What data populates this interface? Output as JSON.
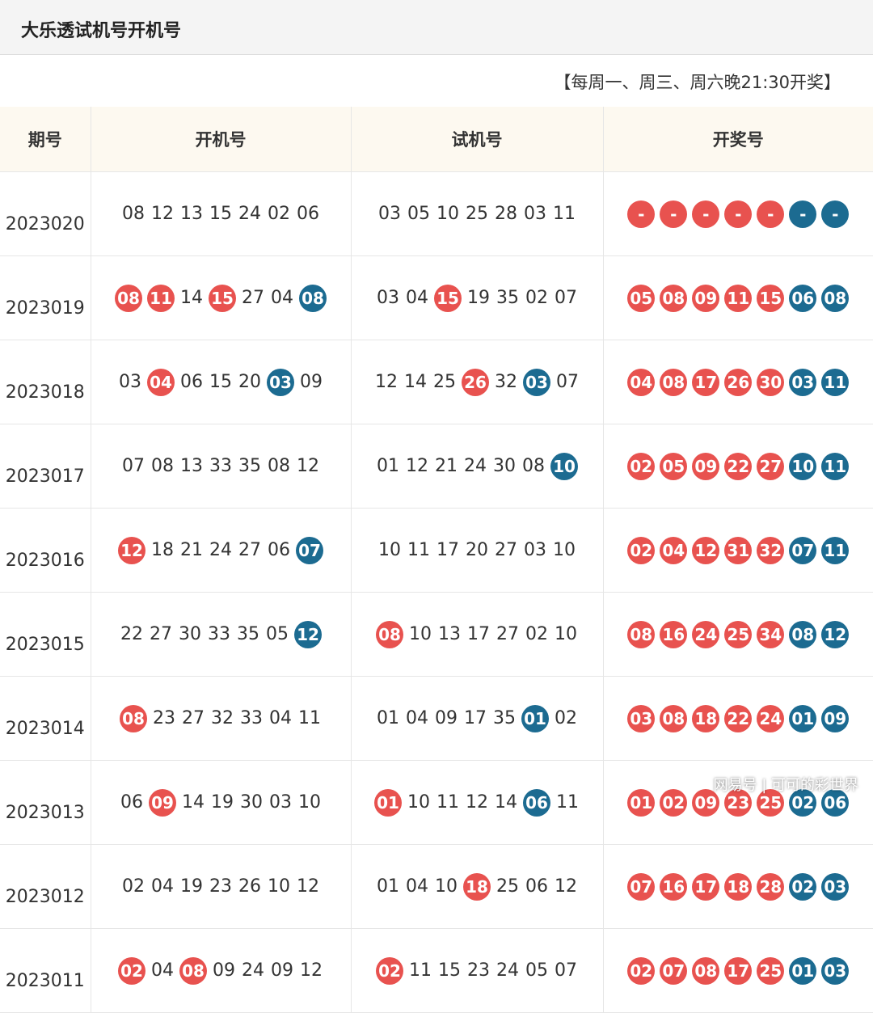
{
  "header": {
    "title": "大乐透试机号开机号"
  },
  "schedule": "【每周一、周三、周六晚21:30开奖】",
  "columns": [
    "期号",
    "开机号",
    "试机号",
    "开奖号"
  ],
  "colors": {
    "red_ball": "#e8524f",
    "blue_ball": "#1c6b91",
    "header_bg": "#fdf9f0"
  },
  "rows": [
    {
      "period": "2023020",
      "open": [
        {
          "n": "08",
          "c": ""
        },
        {
          "n": "12",
          "c": ""
        },
        {
          "n": "13",
          "c": ""
        },
        {
          "n": "15",
          "c": ""
        },
        {
          "n": "24",
          "c": ""
        },
        {
          "n": "02",
          "c": ""
        },
        {
          "n": "06",
          "c": ""
        }
      ],
      "test": [
        {
          "n": "03",
          "c": ""
        },
        {
          "n": "05",
          "c": ""
        },
        {
          "n": "10",
          "c": ""
        },
        {
          "n": "25",
          "c": ""
        },
        {
          "n": "28",
          "c": ""
        },
        {
          "n": "03",
          "c": ""
        },
        {
          "n": "11",
          "c": ""
        }
      ],
      "result": [
        {
          "n": "-",
          "c": "red"
        },
        {
          "n": "-",
          "c": "red"
        },
        {
          "n": "-",
          "c": "red"
        },
        {
          "n": "-",
          "c": "red"
        },
        {
          "n": "-",
          "c": "red"
        },
        {
          "n": "-",
          "c": "blue"
        },
        {
          "n": "-",
          "c": "blue"
        }
      ]
    },
    {
      "period": "2023019",
      "open": [
        {
          "n": "08",
          "c": "red"
        },
        {
          "n": "11",
          "c": "red"
        },
        {
          "n": "14",
          "c": ""
        },
        {
          "n": "15",
          "c": "red"
        },
        {
          "n": "27",
          "c": ""
        },
        {
          "n": "04",
          "c": ""
        },
        {
          "n": "08",
          "c": "blue"
        }
      ],
      "test": [
        {
          "n": "03",
          "c": ""
        },
        {
          "n": "04",
          "c": ""
        },
        {
          "n": "15",
          "c": "red"
        },
        {
          "n": "19",
          "c": ""
        },
        {
          "n": "35",
          "c": ""
        },
        {
          "n": "02",
          "c": ""
        },
        {
          "n": "07",
          "c": ""
        }
      ],
      "result": [
        {
          "n": "05",
          "c": "red"
        },
        {
          "n": "08",
          "c": "red"
        },
        {
          "n": "09",
          "c": "red"
        },
        {
          "n": "11",
          "c": "red"
        },
        {
          "n": "15",
          "c": "red"
        },
        {
          "n": "06",
          "c": "blue"
        },
        {
          "n": "08",
          "c": "blue"
        }
      ]
    },
    {
      "period": "2023018",
      "open": [
        {
          "n": "03",
          "c": ""
        },
        {
          "n": "04",
          "c": "red"
        },
        {
          "n": "06",
          "c": ""
        },
        {
          "n": "15",
          "c": ""
        },
        {
          "n": "20",
          "c": ""
        },
        {
          "n": "03",
          "c": "blue"
        },
        {
          "n": "09",
          "c": ""
        }
      ],
      "test": [
        {
          "n": "12",
          "c": ""
        },
        {
          "n": "14",
          "c": ""
        },
        {
          "n": "25",
          "c": ""
        },
        {
          "n": "26",
          "c": "red"
        },
        {
          "n": "32",
          "c": ""
        },
        {
          "n": "03",
          "c": "blue"
        },
        {
          "n": "07",
          "c": ""
        }
      ],
      "result": [
        {
          "n": "04",
          "c": "red"
        },
        {
          "n": "08",
          "c": "red"
        },
        {
          "n": "17",
          "c": "red"
        },
        {
          "n": "26",
          "c": "red"
        },
        {
          "n": "30",
          "c": "red"
        },
        {
          "n": "03",
          "c": "blue"
        },
        {
          "n": "11",
          "c": "blue"
        }
      ]
    },
    {
      "period": "2023017",
      "open": [
        {
          "n": "07",
          "c": ""
        },
        {
          "n": "08",
          "c": ""
        },
        {
          "n": "13",
          "c": ""
        },
        {
          "n": "33",
          "c": ""
        },
        {
          "n": "35",
          "c": ""
        },
        {
          "n": "08",
          "c": ""
        },
        {
          "n": "12",
          "c": ""
        }
      ],
      "test": [
        {
          "n": "01",
          "c": ""
        },
        {
          "n": "12",
          "c": ""
        },
        {
          "n": "21",
          "c": ""
        },
        {
          "n": "24",
          "c": ""
        },
        {
          "n": "30",
          "c": ""
        },
        {
          "n": "08",
          "c": ""
        },
        {
          "n": "10",
          "c": "blue"
        }
      ],
      "result": [
        {
          "n": "02",
          "c": "red"
        },
        {
          "n": "05",
          "c": "red"
        },
        {
          "n": "09",
          "c": "red"
        },
        {
          "n": "22",
          "c": "red"
        },
        {
          "n": "27",
          "c": "red"
        },
        {
          "n": "10",
          "c": "blue"
        },
        {
          "n": "11",
          "c": "blue"
        }
      ]
    },
    {
      "period": "2023016",
      "open": [
        {
          "n": "12",
          "c": "red"
        },
        {
          "n": "18",
          "c": ""
        },
        {
          "n": "21",
          "c": ""
        },
        {
          "n": "24",
          "c": ""
        },
        {
          "n": "27",
          "c": ""
        },
        {
          "n": "06",
          "c": ""
        },
        {
          "n": "07",
          "c": "blue"
        }
      ],
      "test": [
        {
          "n": "10",
          "c": ""
        },
        {
          "n": "11",
          "c": ""
        },
        {
          "n": "17",
          "c": ""
        },
        {
          "n": "20",
          "c": ""
        },
        {
          "n": "27",
          "c": ""
        },
        {
          "n": "03",
          "c": ""
        },
        {
          "n": "10",
          "c": ""
        }
      ],
      "result": [
        {
          "n": "02",
          "c": "red"
        },
        {
          "n": "04",
          "c": "red"
        },
        {
          "n": "12",
          "c": "red"
        },
        {
          "n": "31",
          "c": "red"
        },
        {
          "n": "32",
          "c": "red"
        },
        {
          "n": "07",
          "c": "blue"
        },
        {
          "n": "11",
          "c": "blue"
        }
      ]
    },
    {
      "period": "2023015",
      "open": [
        {
          "n": "22",
          "c": ""
        },
        {
          "n": "27",
          "c": ""
        },
        {
          "n": "30",
          "c": ""
        },
        {
          "n": "33",
          "c": ""
        },
        {
          "n": "35",
          "c": ""
        },
        {
          "n": "05",
          "c": ""
        },
        {
          "n": "12",
          "c": "blue"
        }
      ],
      "test": [
        {
          "n": "08",
          "c": "red"
        },
        {
          "n": "10",
          "c": ""
        },
        {
          "n": "13",
          "c": ""
        },
        {
          "n": "17",
          "c": ""
        },
        {
          "n": "27",
          "c": ""
        },
        {
          "n": "02",
          "c": ""
        },
        {
          "n": "10",
          "c": ""
        }
      ],
      "result": [
        {
          "n": "08",
          "c": "red"
        },
        {
          "n": "16",
          "c": "red"
        },
        {
          "n": "24",
          "c": "red"
        },
        {
          "n": "25",
          "c": "red"
        },
        {
          "n": "34",
          "c": "red"
        },
        {
          "n": "08",
          "c": "blue"
        },
        {
          "n": "12",
          "c": "blue"
        }
      ]
    },
    {
      "period": "2023014",
      "open": [
        {
          "n": "08",
          "c": "red"
        },
        {
          "n": "23",
          "c": ""
        },
        {
          "n": "27",
          "c": ""
        },
        {
          "n": "32",
          "c": ""
        },
        {
          "n": "33",
          "c": ""
        },
        {
          "n": "04",
          "c": ""
        },
        {
          "n": "11",
          "c": ""
        }
      ],
      "test": [
        {
          "n": "01",
          "c": ""
        },
        {
          "n": "04",
          "c": ""
        },
        {
          "n": "09",
          "c": ""
        },
        {
          "n": "17",
          "c": ""
        },
        {
          "n": "35",
          "c": ""
        },
        {
          "n": "01",
          "c": "blue"
        },
        {
          "n": "02",
          "c": ""
        }
      ],
      "result": [
        {
          "n": "03",
          "c": "red"
        },
        {
          "n": "08",
          "c": "red"
        },
        {
          "n": "18",
          "c": "red"
        },
        {
          "n": "22",
          "c": "red"
        },
        {
          "n": "24",
          "c": "red"
        },
        {
          "n": "01",
          "c": "blue"
        },
        {
          "n": "09",
          "c": "blue"
        }
      ]
    },
    {
      "period": "2023013",
      "open": [
        {
          "n": "06",
          "c": ""
        },
        {
          "n": "09",
          "c": "red"
        },
        {
          "n": "14",
          "c": ""
        },
        {
          "n": "19",
          "c": ""
        },
        {
          "n": "30",
          "c": ""
        },
        {
          "n": "03",
          "c": ""
        },
        {
          "n": "10",
          "c": ""
        }
      ],
      "test": [
        {
          "n": "01",
          "c": "red"
        },
        {
          "n": "10",
          "c": ""
        },
        {
          "n": "11",
          "c": ""
        },
        {
          "n": "12",
          "c": ""
        },
        {
          "n": "14",
          "c": ""
        },
        {
          "n": "06",
          "c": "blue"
        },
        {
          "n": "11",
          "c": ""
        }
      ],
      "result": [
        {
          "n": "01",
          "c": "red"
        },
        {
          "n": "02",
          "c": "red"
        },
        {
          "n": "09",
          "c": "red"
        },
        {
          "n": "23",
          "c": "red"
        },
        {
          "n": "25",
          "c": "red"
        },
        {
          "n": "02",
          "c": "blue"
        },
        {
          "n": "06",
          "c": "blue"
        }
      ]
    },
    {
      "period": "2023012",
      "open": [
        {
          "n": "02",
          "c": ""
        },
        {
          "n": "04",
          "c": ""
        },
        {
          "n": "19",
          "c": ""
        },
        {
          "n": "23",
          "c": ""
        },
        {
          "n": "26",
          "c": ""
        },
        {
          "n": "10",
          "c": ""
        },
        {
          "n": "12",
          "c": ""
        }
      ],
      "test": [
        {
          "n": "01",
          "c": ""
        },
        {
          "n": "04",
          "c": ""
        },
        {
          "n": "10",
          "c": ""
        },
        {
          "n": "18",
          "c": "red"
        },
        {
          "n": "25",
          "c": ""
        },
        {
          "n": "06",
          "c": ""
        },
        {
          "n": "12",
          "c": ""
        }
      ],
      "result": [
        {
          "n": "07",
          "c": "red"
        },
        {
          "n": "16",
          "c": "red"
        },
        {
          "n": "17",
          "c": "red"
        },
        {
          "n": "18",
          "c": "red"
        },
        {
          "n": "28",
          "c": "red"
        },
        {
          "n": "02",
          "c": "blue"
        },
        {
          "n": "03",
          "c": "blue"
        }
      ]
    },
    {
      "period": "2023011",
      "open": [
        {
          "n": "02",
          "c": "red"
        },
        {
          "n": "04",
          "c": ""
        },
        {
          "n": "08",
          "c": "red"
        },
        {
          "n": "09",
          "c": ""
        },
        {
          "n": "24",
          "c": ""
        },
        {
          "n": "09",
          "c": ""
        },
        {
          "n": "12",
          "c": ""
        }
      ],
      "test": [
        {
          "n": "02",
          "c": "red"
        },
        {
          "n": "11",
          "c": ""
        },
        {
          "n": "15",
          "c": ""
        },
        {
          "n": "23",
          "c": ""
        },
        {
          "n": "24",
          "c": ""
        },
        {
          "n": "05",
          "c": ""
        },
        {
          "n": "07",
          "c": ""
        }
      ],
      "result": [
        {
          "n": "02",
          "c": "red"
        },
        {
          "n": "07",
          "c": "red"
        },
        {
          "n": "08",
          "c": "red"
        },
        {
          "n": "17",
          "c": "red"
        },
        {
          "n": "25",
          "c": "red"
        },
        {
          "n": "01",
          "c": "blue"
        },
        {
          "n": "03",
          "c": "blue"
        }
      ]
    }
  ],
  "watermark": "网易号 | 可可的彩世界"
}
